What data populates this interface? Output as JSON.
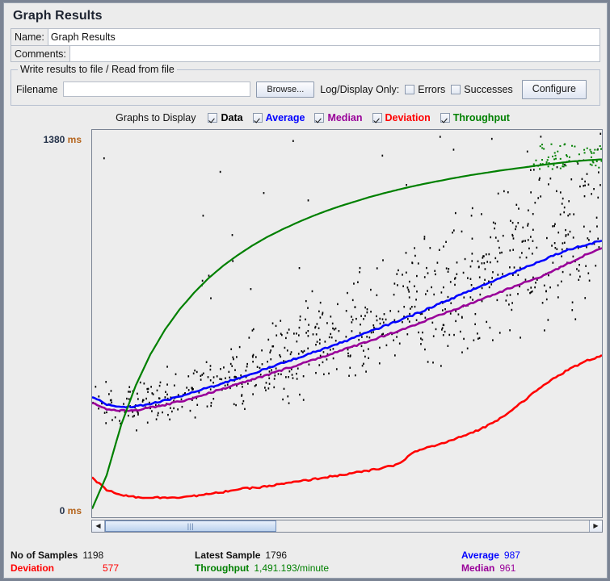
{
  "window": {
    "title": "Graph Results"
  },
  "form": {
    "name_label": "Name:",
    "name_value": "Graph Results",
    "comments_label": "Comments:",
    "comments_value": ""
  },
  "file_group": {
    "legend": "Write results to file / Read from file",
    "filename_label": "Filename",
    "filename_value": "",
    "filename_placeholder": "",
    "browse_label": "Browse...",
    "logdisplay_label": "Log/Display Only:",
    "errors_label": "Errors",
    "errors_checked": false,
    "successes_label": "Successes",
    "successes_checked": false,
    "configure_label": "Configure"
  },
  "graphs_to_display": {
    "label": "Graphs to Display",
    "items": [
      {
        "label": "Data",
        "checked": true,
        "color": "#000000"
      },
      {
        "label": "Average",
        "checked": true,
        "color": "#0000ff"
      },
      {
        "label": "Median",
        "checked": true,
        "color": "#990099"
      },
      {
        "label": "Deviation",
        "checked": true,
        "color": "#ff0000"
      },
      {
        "label": "Throughput",
        "checked": true,
        "color": "#008000"
      }
    ]
  },
  "axis": {
    "y_max_value": "1380",
    "y_max_unit": "ms",
    "y_min_value": "0",
    "y_min_unit": "ms"
  },
  "scrollbar": {
    "left_arrow": "◀",
    "right_arrow": "▶",
    "grip": "|||"
  },
  "stats": {
    "samples_label": "No of Samples",
    "samples_value": "1198",
    "latest_label": "Latest Sample",
    "latest_value": "1796",
    "average_label": "Average",
    "average_value": "987",
    "deviation_label": "Deviation",
    "deviation_value": "577",
    "throughput_label": "Throughput",
    "throughput_value": "1,491.193/minute",
    "median_label": "Median",
    "median_value": "961"
  },
  "chart_data": {
    "type": "line",
    "title": "Graph Results",
    "xlabel": "",
    "ylabel": "ms",
    "ylim": [
      0,
      1380
    ],
    "grid": false,
    "legend": [
      "Data",
      "Average",
      "Median",
      "Deviation",
      "Throughput"
    ],
    "colors": {
      "data": "#000000",
      "average": "#0000ff",
      "median": "#990099",
      "deviation": "#ff0000",
      "throughput": "#008000"
    },
    "n_samples": 1198,
    "series": [
      {
        "name": "Average",
        "color": "#0000ff",
        "values": [
          430,
          400,
          392,
          395,
          404,
          416,
          430,
          446,
          462,
          478,
          495,
          512,
          530,
          548,
          566,
          584,
          602,
          620,
          640,
          660,
          680,
          700,
          720,
          742,
          764,
          786,
          808,
          830,
          852,
          874,
          896,
          918,
          940,
          958,
          972,
          987
        ]
      },
      {
        "name": "Median",
        "color": "#990099",
        "values": [
          408,
          385,
          379,
          382,
          390,
          400,
          412,
          426,
          442,
          458,
          474,
          490,
          507,
          524,
          541,
          558,
          575,
          592,
          610,
          628,
          646,
          664,
          682,
          702,
          722,
          742,
          762,
          782,
          802,
          822,
          842,
          862,
          886,
          912,
          938,
          961
        ]
      },
      {
        "name": "Deviation",
        "color": "#ff0000",
        "values": [
          140,
          98,
          80,
          72,
          70,
          70,
          72,
          76,
          82,
          90,
          100,
          104,
          110,
          118,
          126,
          134,
          142,
          150,
          158,
          166,
          176,
          188,
          230,
          248,
          262,
          280,
          300,
          322,
          352,
          390,
          430,
          470,
          505,
          534,
          558,
          577
        ]
      },
      {
        "name": "Throughput",
        "color": "#008000",
        "values": [
          30,
          150,
          330,
          470,
          580,
          668,
          740,
          800,
          852,
          896,
          934,
          968,
          998,
          1024,
          1048,
          1070,
          1090,
          1108,
          1124,
          1140,
          1154,
          1167,
          1179,
          1190,
          1200,
          1210,
          1219,
          1227,
          1235,
          1242,
          1249,
          1256,
          1262,
          1268,
          1272,
          1275
        ]
      }
    ],
    "scatter": {
      "name": "Data",
      "color": "#000000",
      "description": "Individual sample response times, rising diagonal band from ~400 ms at left to ~1100 ms at right, with sparse outliers up to 1380 ms"
    }
  }
}
